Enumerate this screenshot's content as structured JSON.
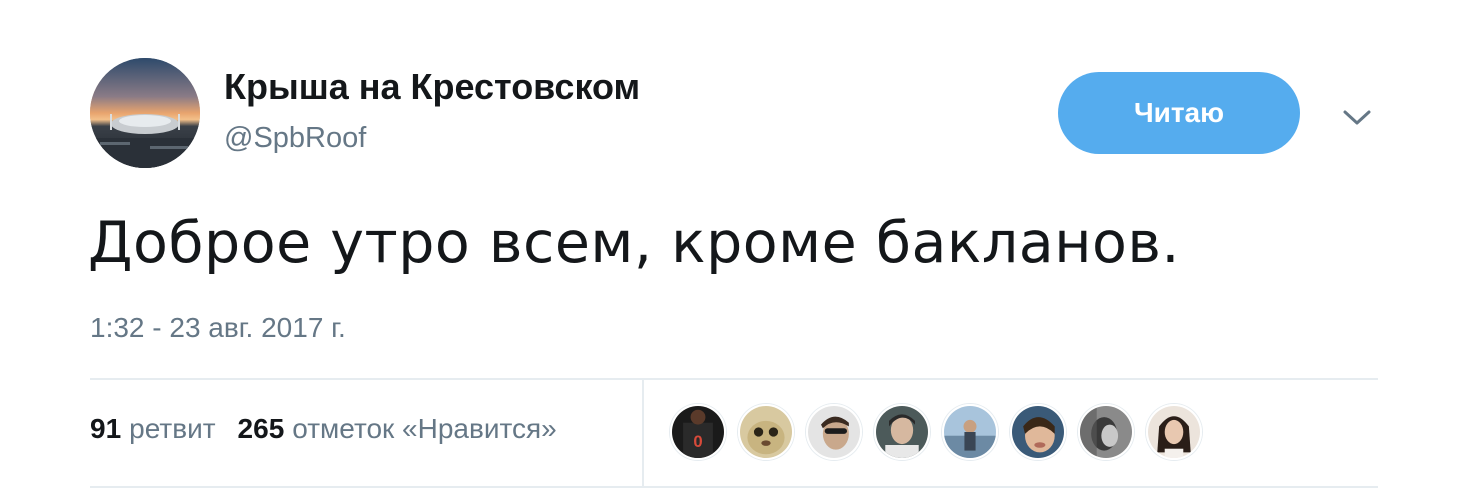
{
  "tweet": {
    "display_name": "Крыша на Крестовском",
    "handle": "@SpbRoof",
    "follow_button_label": "Читаю",
    "text": "Доброе утро всем, кроме бакланов.",
    "timestamp": "1:32 - 23 авг. 2017 г.",
    "avatar_icon": "stadium-avatar",
    "menu_icon": "chevron-down-icon"
  },
  "stats": {
    "retweets_count": "91",
    "retweets_label": "ретвит",
    "likes_count": "265",
    "likes_label": "отметок «Нравится»"
  },
  "likers": [
    {
      "icon": "liker-avatar-1"
    },
    {
      "icon": "liker-avatar-2"
    },
    {
      "icon": "liker-avatar-3"
    },
    {
      "icon": "liker-avatar-4"
    },
    {
      "icon": "liker-avatar-5"
    },
    {
      "icon": "liker-avatar-6"
    },
    {
      "icon": "liker-avatar-7"
    },
    {
      "icon": "liker-avatar-8"
    }
  ],
  "colors": {
    "follow_button_bg": "#55acee",
    "secondary_text": "#657786",
    "primary_text": "#14171a",
    "divider": "#e6ecf0"
  }
}
